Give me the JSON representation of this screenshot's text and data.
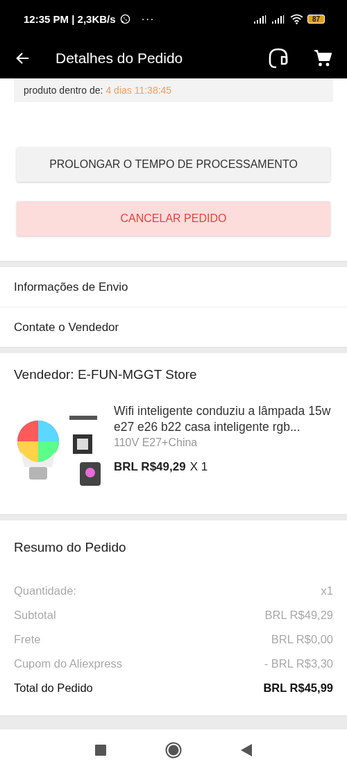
{
  "status_bar": {
    "time": "12:35 PM | 2,3KB/s",
    "more": "···",
    "battery": "87"
  },
  "header": {
    "title": "Detalhes do Pedido"
  },
  "notice": {
    "text_2": "produto dentro de:",
    "countdown": "4 dias 11:38:45"
  },
  "buttons": [
    {
      "label": "PROLONGAR O TEMPO DE PROCESSAMENTO",
      "kind": "neutral"
    },
    {
      "label": "CANCELAR PEDIDO",
      "kind": "danger"
    }
  ],
  "links": [
    {
      "label": "Informações de Envio"
    },
    {
      "label": "Contate o Vendedor"
    }
  ],
  "seller": {
    "label": "Vendedor: E-FUN-MGGT Store"
  },
  "product": {
    "title": "Wifi inteligente conduziu a lâmpada 15w e27 e26 b22 casa inteligente rgb...",
    "variant": "110V E27+China",
    "price": "BRL R$49,29",
    "quantity": "X 1"
  },
  "summary": {
    "title": "Resumo do Pedido",
    "rows": [
      {
        "label": "Quantidade:",
        "value": "x1",
        "kind": "normal"
      },
      {
        "label": "Subtotal",
        "value": "BRL R$49,29",
        "kind": "normal"
      },
      {
        "label": "Frete",
        "value": "BRL R$0,00",
        "kind": "normal"
      },
      {
        "label": "Cupom do Aliexpress",
        "value": "- BRL R$3,30",
        "kind": "normal"
      },
      {
        "label": "Total do Pedido",
        "value": "BRL R$45,99",
        "kind": "total"
      }
    ]
  }
}
